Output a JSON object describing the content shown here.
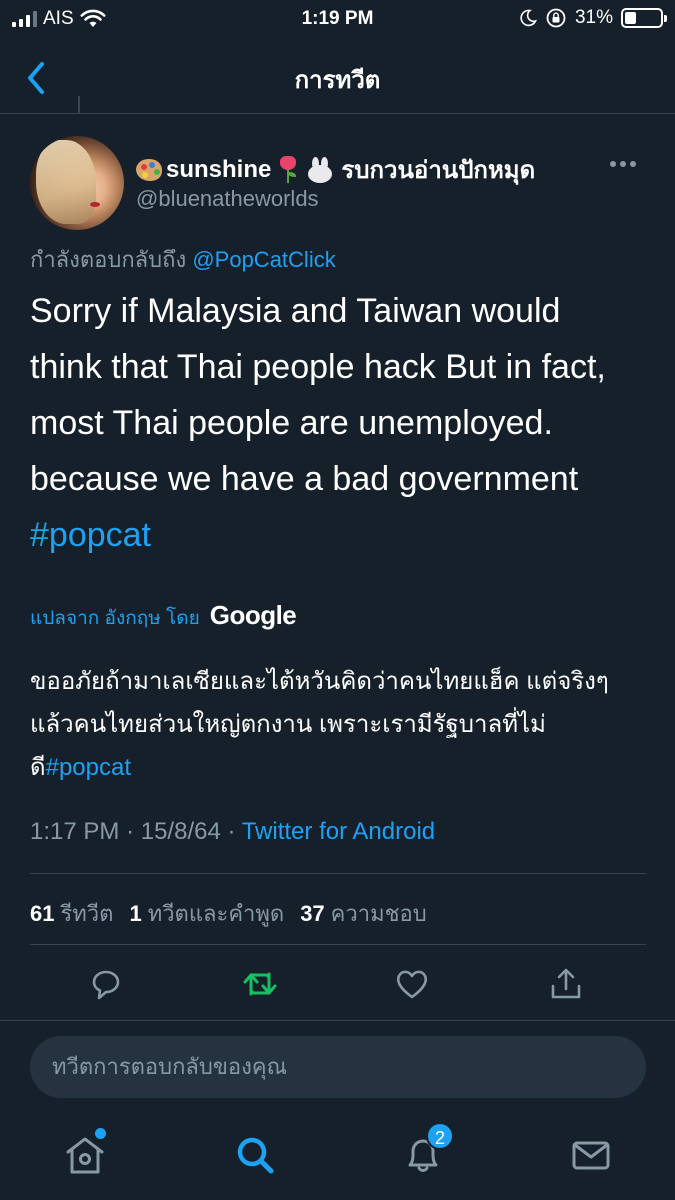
{
  "status_bar": {
    "carrier": "AIS",
    "time": "1:19 PM",
    "battery": "31%",
    "battery_level": 0.31,
    "icons": [
      "signal-icon",
      "wifi-icon",
      "moon-icon",
      "orientation-lock-icon",
      "battery-icon"
    ]
  },
  "header": {
    "title": "การทวีต",
    "back_icon": "chevron-left-icon"
  },
  "tweet": {
    "display_name": "sunshine",
    "display_name_suffix": "รบกวนอ่านปักหมุด",
    "handle": "@bluenatheworlds",
    "reply_prefix": "กำลังตอบกลับถึง",
    "reply_to": "@PopCatClick",
    "text_lines": [
      "Sorry if Malaysia and Taiwan  would",
      "think that Thai people hack  But in fact,",
      "most Thai people are unemployed.",
      "because we have a bad government"
    ],
    "hashtag": "#popcat",
    "translated_from": "แปลจาก อังกฤษ โดย",
    "translator": "Google",
    "translation_lines": [
      "ขออภัยถ้ามาเลเซียและไต้หวันคิดว่าคนไทยแฮ็ค แต่จริงๆ",
      "แล้วคนไทยส่วนใหญ่ตกงาน เพราะเรามีรัฐบาลที่ไม่",
      "ดี"
    ],
    "translation_hashtag": "#popcat",
    "time": "1:17 PM",
    "date": "15/8/64",
    "separator": "·",
    "source": "Twitter for Android"
  },
  "stats": {
    "retweets_count": "61",
    "retweets_label": "รีทวีต",
    "quotes_count": "1",
    "quotes_label": "ทวีตและคำพูด",
    "likes_count": "37",
    "likes_label": "ความชอบ"
  },
  "reply_box": {
    "placeholder": "ทวีตการตอบกลับของคุณ"
  },
  "tabbar": {
    "notifications_badge": "2"
  },
  "colors": {
    "background": "#15202b",
    "accent": "#1da1f2",
    "retweet_green": "#17bf63",
    "muted": "#8899a6",
    "divider": "#38444d"
  }
}
